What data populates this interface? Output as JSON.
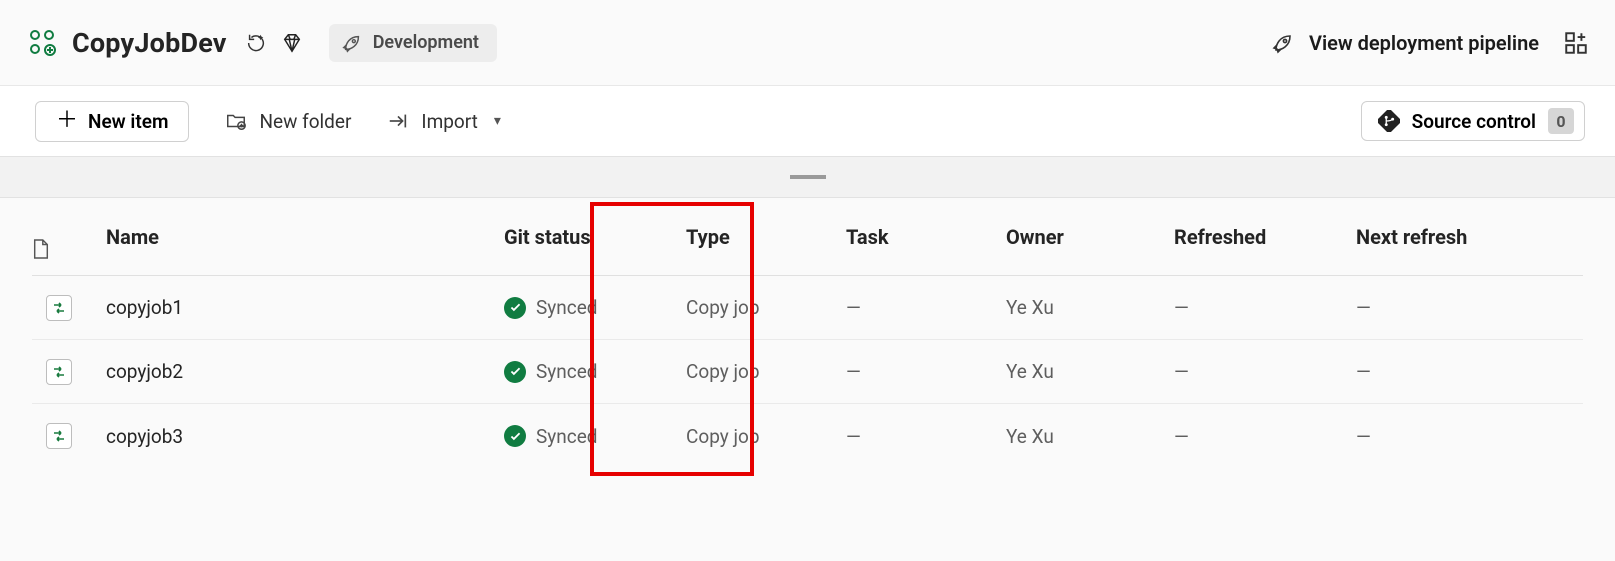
{
  "header": {
    "workspace_name": "CopyJobDev",
    "environment_label": "Development",
    "pipeline_link_label": "View deployment pipeline"
  },
  "toolbar": {
    "new_item_label": "New item",
    "new_folder_label": "New folder",
    "import_label": "Import",
    "source_control_label": "Source control",
    "source_control_count": "0"
  },
  "table": {
    "columns": {
      "name": "Name",
      "git_status": "Git status",
      "type": "Type",
      "task": "Task",
      "owner": "Owner",
      "refreshed": "Refreshed",
      "next_refresh": "Next refresh"
    },
    "rows": [
      {
        "name": "copyjob1",
        "git_status": "Synced",
        "type": "Copy job",
        "task": "—",
        "owner": "Ye Xu",
        "refreshed": "—",
        "next_refresh": "—"
      },
      {
        "name": "copyjob2",
        "git_status": "Synced",
        "type": "Copy job",
        "task": "—",
        "owner": "Ye Xu",
        "refreshed": "—",
        "next_refresh": "—"
      },
      {
        "name": "copyjob3",
        "git_status": "Synced",
        "type": "Copy job",
        "task": "—",
        "owner": "Ye Xu",
        "refreshed": "—",
        "next_refresh": "—"
      }
    ]
  }
}
